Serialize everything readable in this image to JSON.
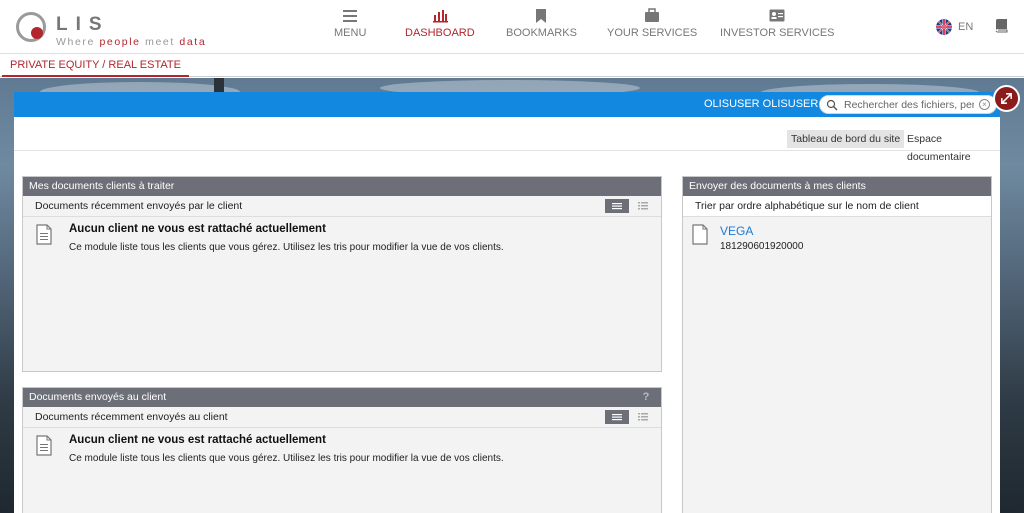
{
  "logo": {
    "text": "LIS",
    "tag_where": "Where",
    "tag_people": "people",
    "tag_meet": "meet",
    "tag_data": "data"
  },
  "nav": {
    "menu": "MENU",
    "dashboard": "DASHBOARD",
    "bookmarks": "BOOKMARKS",
    "your_services": "YOUR SERVICES",
    "investor_services": "INVESTOR SERVICES"
  },
  "lang": "EN",
  "subbar": {
    "tab": "PRIVATE EQUITY / REAL ESTATE"
  },
  "topbar": {
    "user": "OLISUSER OLISUSER ▾",
    "search_placeholder": "Rechercher des fichiers, perso"
  },
  "tabs": {
    "dashboard": "Tableau de bord du site",
    "docs": "Espace documentaire"
  },
  "card1": {
    "title": "Mes documents clients à traiter",
    "sub": "Documents récemment envoyés par le client",
    "empty_title": "Aucun client ne vous est rattaché actuellement",
    "empty_text": "Ce module liste tous les clients que vous gérez. Utilisez les tris pour modifier la vue de vos clients."
  },
  "card2": {
    "title": "Documents envoyés au client",
    "sub": "Documents récemment envoyés au client",
    "help": "?",
    "empty_title": "Aucun client ne vous est rattaché actuellement",
    "empty_text": "Ce module liste tous les clients que vous gérez. Utilisez les tris pour modifier la vue de vos clients."
  },
  "card3": {
    "title": "Envoyer des documents à mes clients",
    "sub": "Trier par ordre alphabétique sur le nom de client",
    "client_name": "VEGA",
    "client_id": "181290601920000"
  },
  "colors": {
    "accent": "#b3262d",
    "blue": "#1288e0",
    "card_header": "#6d6f78"
  }
}
